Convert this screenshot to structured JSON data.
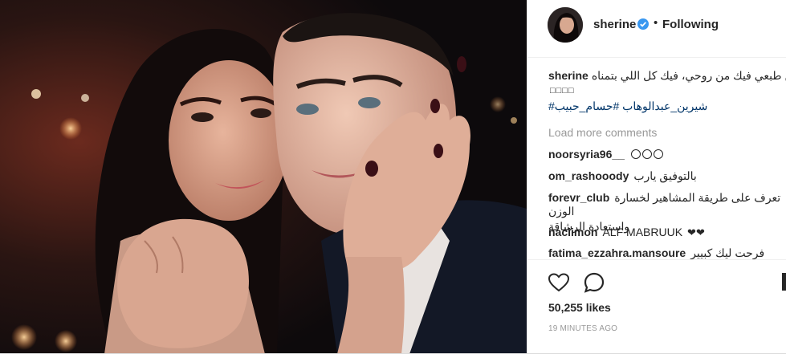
{
  "post": {
    "username": "sherine",
    "following_label": "Following",
    "separator": "•",
    "caption_user": "sherine",
    "caption_text": "فيك من طبعي فيك من روحي، فيك كل اللي بتمناه",
    "caption_glyphs": "□□□□",
    "hashtags": "#شيرين_عبدالوهاب #حسام_حبيب",
    "load_more": "Load more comments",
    "likes": "50,255 likes",
    "time": "19 MINUTES AGO"
  },
  "comments": [
    {
      "user": "noorsyria96__",
      "text": ""
    },
    {
      "user": "om_rashooody",
      "text": "بالتوفيق يارب"
    },
    {
      "user": "forevr_club",
      "text": "تعرف على طريقة المشاهير لخسارة الوزن",
      "text2": "واستعادة الرشاقة"
    },
    {
      "user": "naciimon",
      "text": "ALF MABRUUK"
    },
    {
      "user": "fatima_ezzahra.mansoure",
      "text": "فرحت ليك كبيير"
    }
  ],
  "colors": {
    "hashtag": "#003569",
    "muted": "#999999",
    "text": "#262626",
    "verified": "#3897f0"
  },
  "icons": [
    "verified-badge-icon",
    "heart-icon",
    "comment-bubble-icon",
    "bookmark-icon",
    "face-emoji-icon",
    "black-heart-icon"
  ]
}
